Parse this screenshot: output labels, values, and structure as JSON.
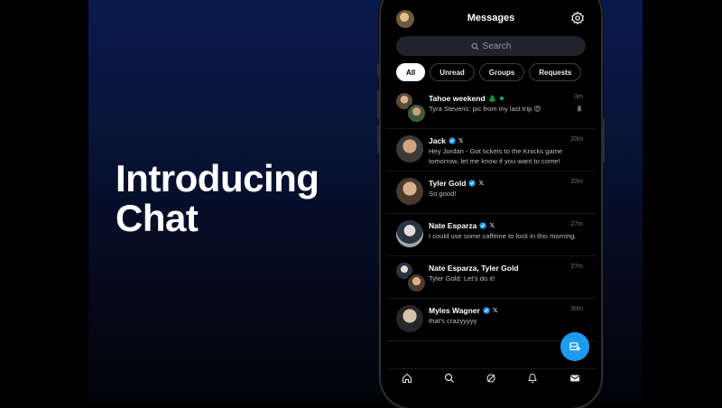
{
  "headline": {
    "line1": "Introducing",
    "line2": "Chat"
  },
  "app": {
    "title": "Messages",
    "search_placeholder": "Search",
    "filters": [
      "All",
      "Unread",
      "Groups",
      "Requests"
    ],
    "conversations": [
      {
        "name": "Tahoe weekend",
        "emoji": "🌲",
        "verified": false,
        "x_badge": false,
        "time": "3m",
        "message": "Tyra Stevens: pic from my last trip 😍",
        "group": true
      },
      {
        "name": "Jack",
        "verified": true,
        "x_badge": true,
        "time": "20m",
        "message": "Hey Jordan - Got tickets to the Knicks game tomorrow, let me know if you want to come!",
        "group": false
      },
      {
        "name": "Tyler Gold",
        "verified": true,
        "x_badge": true,
        "time": "20m",
        "message": "So good!",
        "group": false
      },
      {
        "name": "Nate Esparza",
        "verified": true,
        "x_badge": true,
        "time": "27m",
        "message": "I could use some caffeine to lock in this morning.",
        "group": false
      },
      {
        "name": "Nate Esparza, Tyler Gold",
        "verified": false,
        "x_badge": false,
        "time": "27m",
        "message": "Tyler Gold: Let's do it!",
        "group": true
      },
      {
        "name": "Myles Wagner",
        "verified": true,
        "x_badge": true,
        "time": "30m",
        "message": "that's crazyyyyy",
        "group": false
      }
    ],
    "badge_x_label": "𝕏",
    "colors": {
      "accent": "#1d9bf0",
      "background": "#000000",
      "stage_top": "#0b1a4e"
    },
    "icons": [
      "gear-icon",
      "search-icon",
      "compose-message-icon",
      "home-icon",
      "explore-icon",
      "grok-icon",
      "notifications-icon",
      "messages-icon"
    ]
  }
}
